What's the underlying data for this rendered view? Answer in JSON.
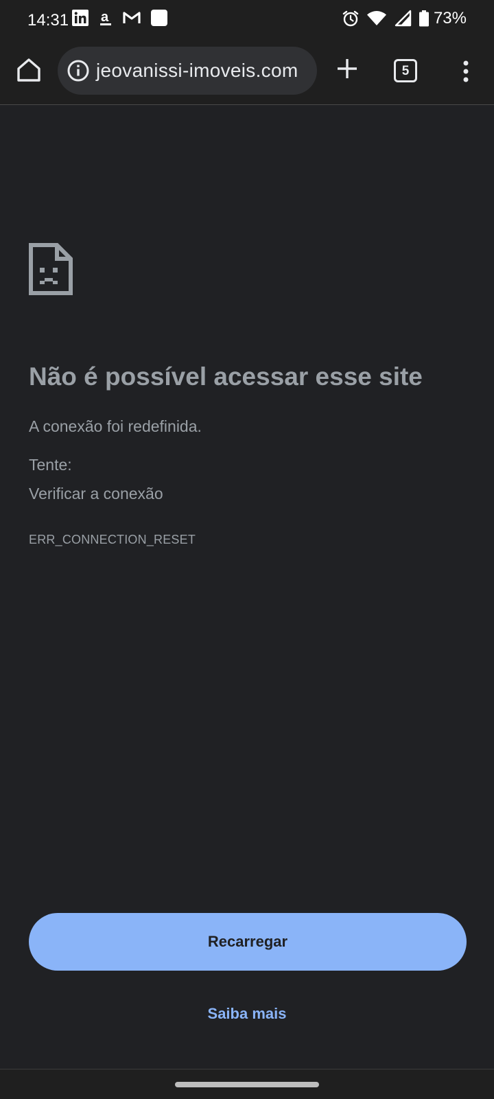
{
  "status_bar": {
    "time": "14:31",
    "battery": "73%",
    "notification_icons": [
      "linkedin-icon",
      "amazon-icon",
      "gmail-icon",
      "square-notification-icon"
    ],
    "system_icons": [
      "alarm-icon",
      "wifi-icon",
      "signal-icon",
      "battery-icon"
    ]
  },
  "toolbar": {
    "url": "jeovanissi-imoveis.com",
    "tab_count": "5"
  },
  "error_page": {
    "title": "Não é possível acessar esse site",
    "description": "A conexão foi redefinida.",
    "try_label": "Tente:",
    "suggestion": "Verificar a conexão",
    "error_code": "ERR_CONNECTION_RESET",
    "reload_label": "Recarregar",
    "learn_more_label": "Saiba mais"
  },
  "colors": {
    "background": "#202124",
    "accent": "#8ab4f8",
    "text_secondary": "#9aa0a6"
  }
}
